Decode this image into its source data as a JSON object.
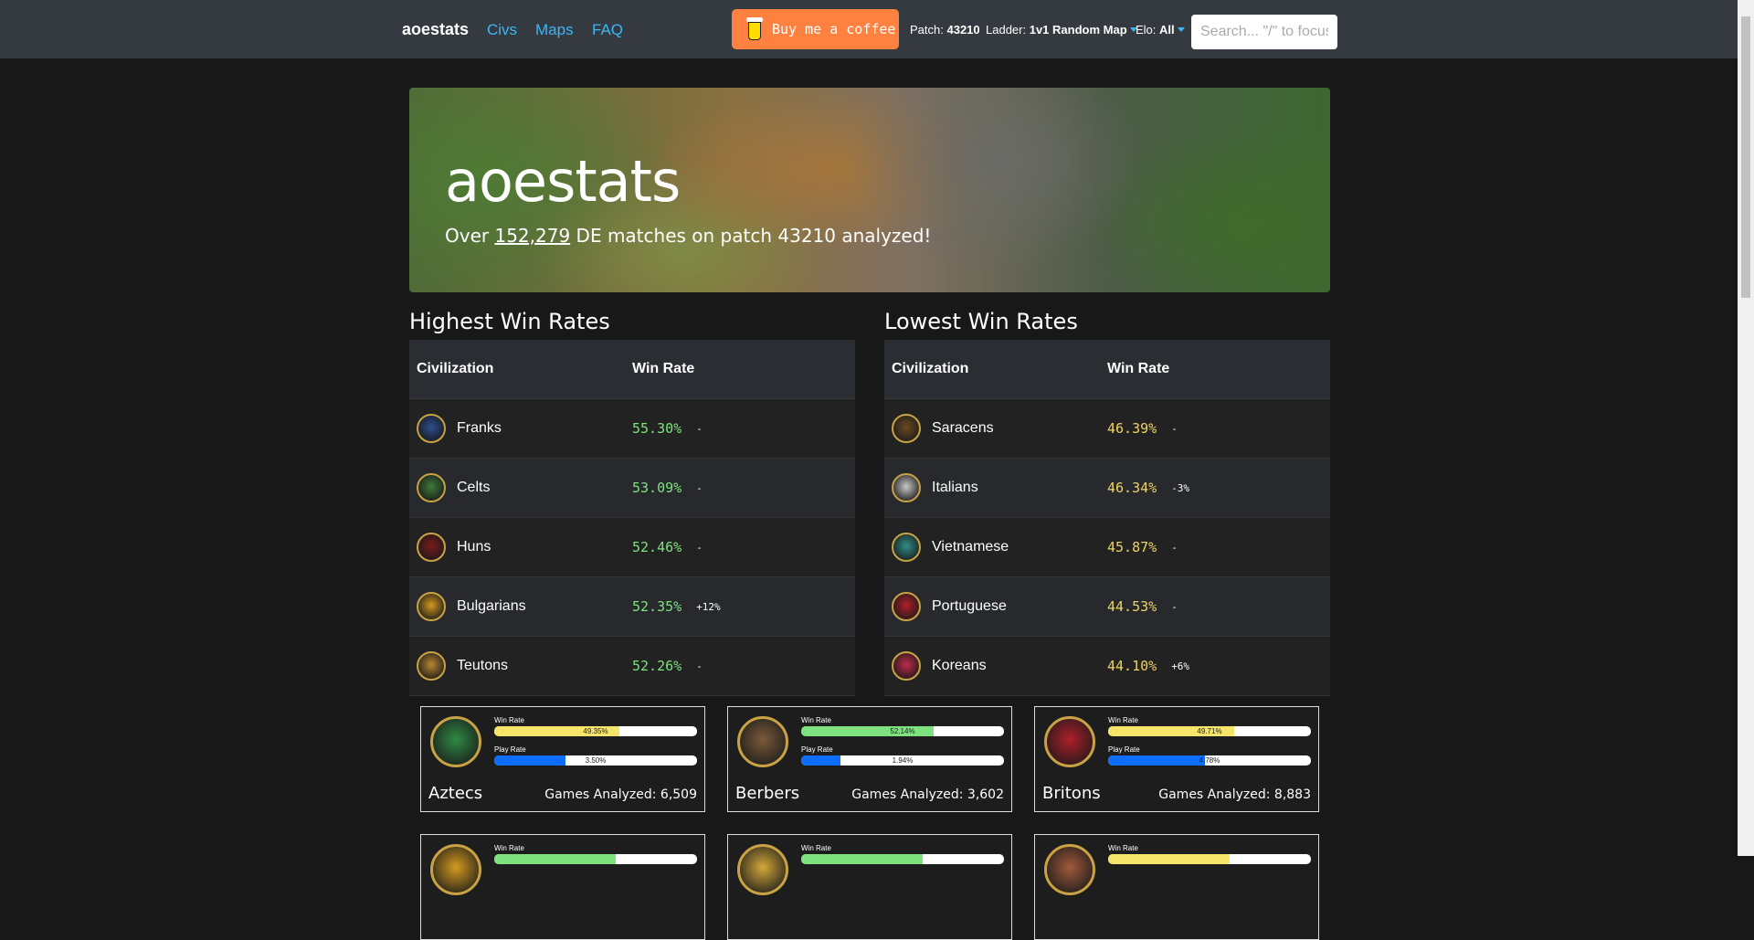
{
  "nav": {
    "brand": "aoestats",
    "links": [
      "Civs",
      "Maps",
      "FAQ"
    ],
    "coffee_label": "Buy me a coffee",
    "patch_label": "Patch:",
    "patch_value": "43210",
    "ladder_label": "Ladder:",
    "ladder_value": "1v1 Random Map",
    "elo_label": "Elo:",
    "elo_value": "All",
    "search_placeholder": "Search... \"/\" to focus",
    "colors": {
      "bar": "#343a40",
      "link": "#3bb8f5",
      "coffee": "#ff813f"
    }
  },
  "hero": {
    "title": "aoestats",
    "sub_prefix": "Over ",
    "match_count": "152,279",
    "sub_suffix": " DE matches on patch 43210 analyzed!"
  },
  "highest": {
    "title": "Highest Win Rates",
    "col_civ": "Civilization",
    "col_wr": "Win Rate",
    "rows": [
      {
        "name": "Franks",
        "wr": "55.30%",
        "delta": "-",
        "icon": "franks-emblem-icon",
        "color": "#2b4d8f"
      },
      {
        "name": "Celts",
        "wr": "53.09%",
        "delta": "-",
        "icon": "celts-emblem-icon",
        "color": "#3e7a3a"
      },
      {
        "name": "Huns",
        "wr": "52.46%",
        "delta": "-",
        "icon": "huns-emblem-icon",
        "color": "#7a1a1a"
      },
      {
        "name": "Bulgarians",
        "wr": "52.35%",
        "delta": "+12%",
        "icon": "bulgarians-emblem-icon",
        "color": "#d49a1e"
      },
      {
        "name": "Teutons",
        "wr": "52.26%",
        "delta": "-",
        "icon": "teutons-emblem-icon",
        "color": "#b8862f"
      }
    ]
  },
  "lowest": {
    "title": "Lowest Win Rates",
    "col_civ": "Civilization",
    "col_wr": "Win Rate",
    "rows": [
      {
        "name": "Saracens",
        "wr": "46.39%",
        "delta": "-",
        "icon": "saracens-emblem-icon",
        "color": "#6b4a1f"
      },
      {
        "name": "Italians",
        "wr": "46.34%",
        "delta": "-3%",
        "icon": "italians-emblem-icon",
        "color": "#c8c8c8"
      },
      {
        "name": "Vietnamese",
        "wr": "45.87%",
        "delta": "-",
        "icon": "vietnamese-emblem-icon",
        "color": "#2f8f8a"
      },
      {
        "name": "Portuguese",
        "wr": "44.53%",
        "delta": "-",
        "icon": "portuguese-emblem-icon",
        "color": "#b01e2a"
      },
      {
        "name": "Koreans",
        "wr": "44.10%",
        "delta": "+6%",
        "icon": "koreans-emblem-icon",
        "color": "#c02a4a"
      }
    ]
  },
  "cards": [
    {
      "name": "Aztecs",
      "games_label": "Games Analyzed:",
      "games": "6,509",
      "win_label": "Win Rate",
      "win_rate": "49.35%",
      "win_value": 49.35,
      "win_color": "#f5e56b",
      "play_label": "Play Rate",
      "play_rate": "3.50%",
      "play_value": 3.5,
      "icon": "aztecs-emblem-icon",
      "color": "#2e8a43"
    },
    {
      "name": "Berbers",
      "games_label": "Games Analyzed:",
      "games": "3,602",
      "win_label": "Win Rate",
      "win_rate": "52.14%",
      "win_value": 52.14,
      "win_color": "#7ee37e",
      "play_label": "Play Rate",
      "play_rate": "1.94%",
      "play_value": 1.94,
      "icon": "berbers-emblem-icon",
      "color": "#7a5a3a"
    },
    {
      "name": "Britons",
      "games_label": "Games Analyzed:",
      "games": "8,883",
      "win_label": "Win Rate",
      "win_rate": "49.71%",
      "win_value": 49.71,
      "win_color": "#f5e56b",
      "play_label": "Play Rate",
      "play_rate": "4.78%",
      "play_value": 4.78,
      "icon": "britons-emblem-icon",
      "color": "#b01e2a"
    }
  ],
  "cards_row2": [
    {
      "win_label": "Win Rate",
      "icon": "bulgarians-emblem-icon",
      "color": "#d49a1e",
      "win_color": "#7ee37e"
    },
    {
      "win_label": "Win Rate",
      "icon": "burgundians-emblem-icon",
      "color": "#d4a83a",
      "win_color": "#7ee37e"
    },
    {
      "win_label": "Win Rate",
      "icon": "burmese-emblem-icon",
      "color": "#a05a3a",
      "win_color": "#f5e56b"
    }
  ],
  "bar_scale": {
    "win_max": 80,
    "play_max": 10,
    "play_color": "#0d6efd"
  }
}
